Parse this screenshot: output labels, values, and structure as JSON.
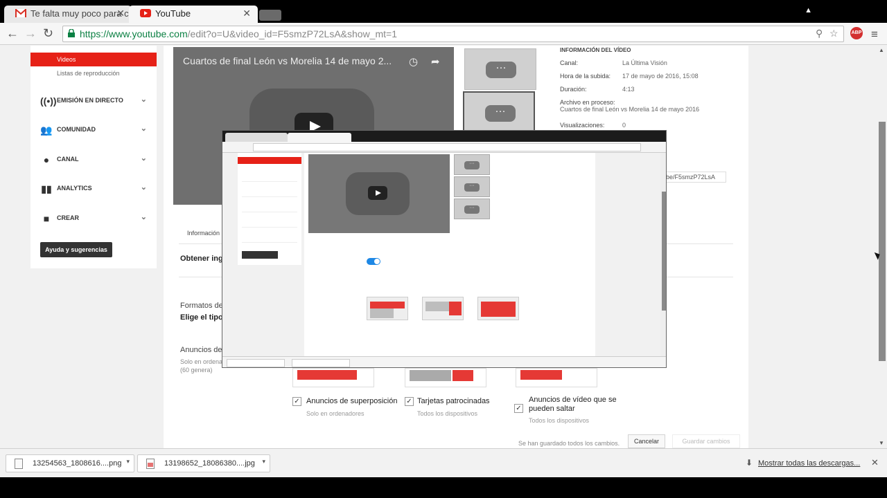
{
  "browser": {
    "tabs": [
      {
        "title": "Te falta muy poco para c",
        "icon": "gmail-icon"
      },
      {
        "title": "YouTube",
        "icon": "youtube-icon"
      }
    ],
    "url_host": "https://www.youtube.com",
    "url_path": "/edit?o=U&video_id=F5smzP72LsA&show_mt=1"
  },
  "sidebar": {
    "active": "Videos",
    "sub": "Listas de reproducción",
    "items": [
      {
        "label": "EMISIÓN EN DIRECTO",
        "icon": "broadcast-icon"
      },
      {
        "label": "COMUNIDAD",
        "icon": "people-icon"
      },
      {
        "label": "CANAL",
        "icon": "account-icon"
      },
      {
        "label": "ANALYTICS",
        "icon": "bar-chart-icon"
      },
      {
        "label": "CREAR",
        "icon": "camera-icon"
      }
    ],
    "help_button": "Ayuda y sugerencias"
  },
  "video": {
    "title": "Cuartos de final León vs Morelia 14 de mayo 2..."
  },
  "info": {
    "heading": "INFORMACIÓN DEL VÍDEO",
    "channel_label": "Canal:",
    "channel_value": "La Última Visión",
    "uploaded_label": "Hora de la subida:",
    "uploaded_value": "17 de mayo de 2016, 15:08",
    "duration_label": "Duración:",
    "duration_value": "4:13",
    "file_label": "Archivo en proceso:",
    "file_value": "Cuartos de final León vs Morelia 14 de mayo 2016",
    "views_label": "Visualizaciones:",
    "views_value": "0",
    "short_url": "be/F5smzP72LsA"
  },
  "content": {
    "tab_info": "Información",
    "monetize_title": "Obtener ingr",
    "formats_title": "Formatos de",
    "formats_sub": "Elige el tipo",
    "ads_title": "Anuncios de",
    "ads_sub1": "Solo en ordena",
    "ads_sub2": "(60 genera)"
  },
  "ad_types": [
    {
      "label": "Anuncios de superposición",
      "sub": "Solo en ordenadores"
    },
    {
      "label": "Tarjetas patrocinadas",
      "sub": "Todos los dispositivos"
    },
    {
      "label": "Anuncios de vídeo que se pueden saltar",
      "sub": "Todos los dispositivos"
    }
  ],
  "footer": {
    "note": "Se han guardado todos los cambios.",
    "cancel": "Cancelar",
    "save": "Guardar cambios"
  },
  "downloads": {
    "items": [
      {
        "name": "13254563_1808616....png"
      },
      {
        "name": "13198652_18086380....jpg"
      }
    ],
    "show_all": "Mostrar todas las descargas..."
  }
}
